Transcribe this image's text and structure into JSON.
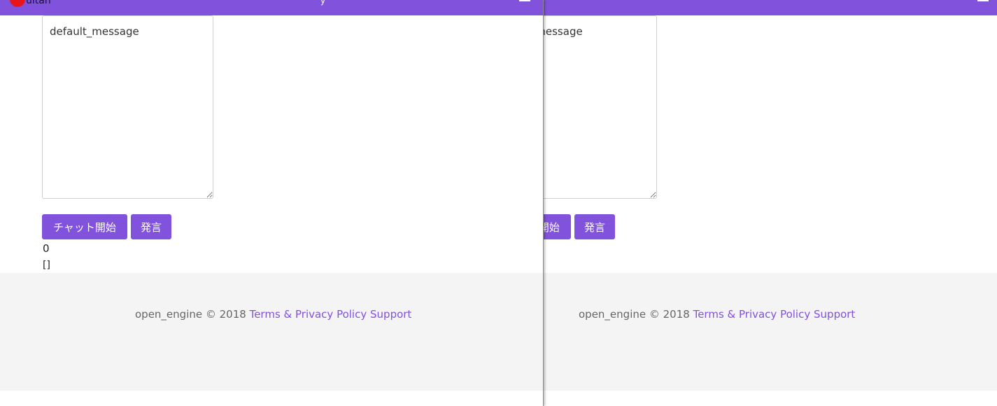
{
  "navbar": {
    "brand": "uitan",
    "title_fragment": "y",
    "menu_icon": "hamburger-menu-icon",
    "bg_color": "#8152dc"
  },
  "chat": {
    "textarea_value": "default_message",
    "start_button_label": "チャット開始",
    "speak_button_label": "発言",
    "counter": "0",
    "messages_output": "[]"
  },
  "footer": {
    "copyright": "open_engine © 2018",
    "links": [
      "Terms & Privacy Policy",
      "Support"
    ]
  },
  "colors": {
    "accent": "#8152dc",
    "logo": "#e8151b",
    "footer_bg": "#f4f4f4",
    "footer_text": "#666666"
  }
}
